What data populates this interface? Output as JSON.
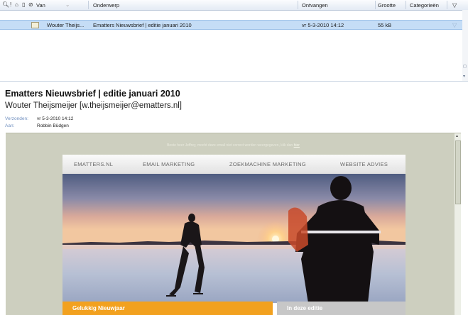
{
  "message_list": {
    "columns": {
      "from": "Van",
      "subject": "Onderwerp",
      "received": "Ontvangen",
      "size": "Grootte",
      "categories": "Categorieën"
    },
    "icons": [
      "importance-icon",
      "reminder-icon",
      "message-type-icon",
      "attachment-icon",
      "flag-filter-icon"
    ],
    "rows": [
      {
        "from": "Wouter Theijs...",
        "subject": "Ematters Nieuwsbrief | editie januari 2010",
        "received": "vr 5-3-2010 14:12",
        "size": "55 kB",
        "selected": true
      }
    ]
  },
  "reading_pane": {
    "subject": "Ematters Nieuwsbrief | editie januari 2010",
    "sender": "Wouter Theijsmeijer [w.theijsmeijer@ematters.nl]",
    "sent_label": "Verzonden:",
    "sent_value": "vr 5-3-2010 14:12",
    "to_label": "Aan:",
    "to_value": "Robbin Büdgen"
  },
  "newsletter": {
    "notice_text": "Beste heer Jeffrey, mocht deze email niet correct worden weergegeven, klik dan",
    "notice_link": "hier",
    "nav": [
      "EMATTERS.NL",
      "EMAIL MARKETING",
      "ZOEKMACHINE MARKETING",
      "WEBSITE ADVIES"
    ],
    "hero_image": "ice-skaters-at-sunset",
    "section_left": "Gelukkig Nieuwjaar",
    "section_right": "In deze editie"
  },
  "colors": {
    "selection": "#c5ddf6",
    "body_bg": "#cdcfbf",
    "accent_orange": "#f2a11f",
    "link_label": "#6f8fbf"
  }
}
